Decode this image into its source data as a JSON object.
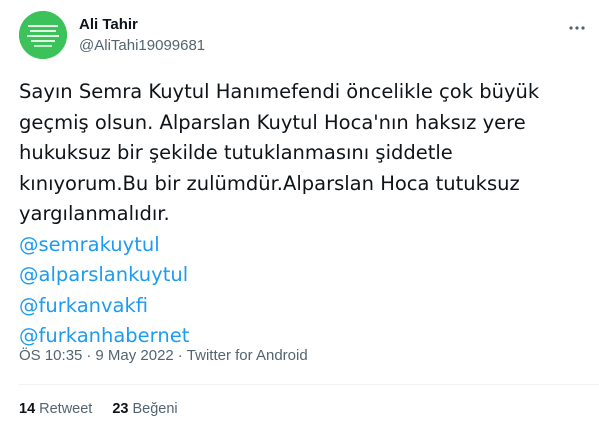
{
  "author": {
    "name": "Ali Tahir",
    "handle": "@AliTahi19099681",
    "avatar_color": "#3cc25a",
    "more_icon": "more-dots-icon"
  },
  "tweet": {
    "lines": [
      "Sayın Semra Kuytul Hanımefendi öncelikle çok büyük",
      "geçmiş olsun. Alparslan Kuytul Hoca'nın haksız yere",
      "hukuksuz bir şekilde tutuklanmasını şiddetle",
      "kınıyorum.Bu bir zulümdür.Alparslan Hoca tutuksuz",
      "yargılanmalıdır."
    ],
    "mentions": [
      "@semrakuytul",
      "@alparslankuytul",
      "@furkanvakfi",
      "@furkanhabernet"
    ]
  },
  "meta": {
    "time": "ÖS 10:35",
    "separator_1": "·",
    "date": "9 May 2022",
    "separator_2": "·",
    "source": "Twitter for Android"
  },
  "stats": {
    "retweets_count": "14",
    "retweets_label": "Retweet",
    "likes_count": "23",
    "likes_label": "Beğeni"
  },
  "colors": {
    "text": "#0f1419",
    "secondary": "#536471",
    "link": "#1d9bf0",
    "divider": "#eff3f4"
  }
}
